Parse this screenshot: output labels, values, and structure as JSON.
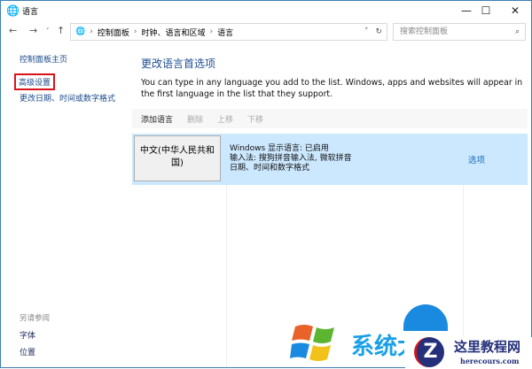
{
  "window": {
    "title": "语言"
  },
  "address": {
    "crumbs": [
      "控制面板",
      "时钟、语言和区域",
      "语言"
    ],
    "search_placeholder": "搜索控制面板"
  },
  "sidebar": {
    "items": [
      "控制面板主页",
      "高级设置",
      "更改日期、时间或数字格式"
    ],
    "see_also_title": "另请参阅",
    "see_also": [
      "字体",
      "位置"
    ]
  },
  "main": {
    "heading": "更改语言首选项",
    "description": "You can type in any language you add to the list. Windows, apps and websites will appear in the first language in the list that they support.",
    "toolbar": [
      "添加语言",
      "删除",
      "上移",
      "下移"
    ],
    "languages": [
      {
        "name": "中文(中华人民共和国)",
        "details": [
          "Windows 显示语言: 已启用",
          "输入法: 搜狗拼音输入法, 微软拼音",
          "日期、时间和数字格式"
        ],
        "options": "选项"
      }
    ]
  },
  "watermark": {
    "site_cn": "这里教程网",
    "site_url": "herecours.com",
    "logo_text": "系统大全"
  },
  "colors": {
    "accent": "#1e4d96",
    "selected_row": "#cce8ff",
    "highlight_box": "#d8141a"
  }
}
